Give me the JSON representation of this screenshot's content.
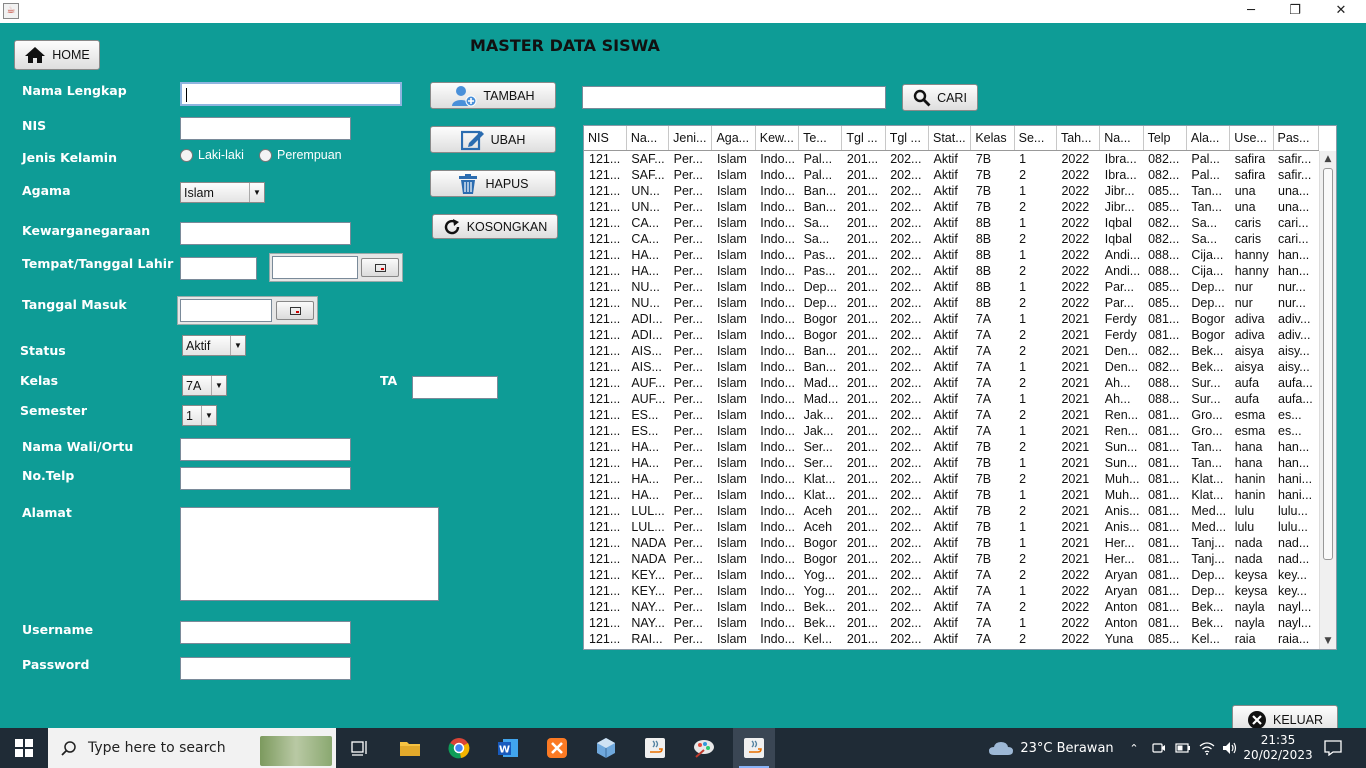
{
  "window": {
    "minimize_icon": "─",
    "maximize_icon": "❐",
    "close_icon": "✕"
  },
  "form": {
    "title": "MASTER DATA SISWA",
    "home_label": "HOME",
    "labels": {
      "nama_lengkap": "Nama Lengkap",
      "nis": "NIS",
      "jenis_kelamin": "Jenis Kelamin",
      "agama": "Agama",
      "kewarganegaraan": "Kewarganegaraan",
      "tempat_tanggal_lahir": "Tempat/Tanggal Lahir",
      "tanggal_masuk": "Tanggal Masuk",
      "status": "Status",
      "kelas": "Kelas",
      "semester": "Semester",
      "ta": "TA",
      "nama_wali": "Nama Wali/Ortu",
      "no_telp": "No.Telp",
      "alamat": "Alamat",
      "username": "Username",
      "password": "Password"
    },
    "gender_options": [
      "Laki-laki",
      "Perempuan"
    ],
    "agama_value": "Islam",
    "status_value": "Aktif",
    "kelas_value": "7A",
    "semester_value": "1",
    "buttons": {
      "tambah": "TAMBAH",
      "ubah": "UBAH",
      "hapus": "HAPUS",
      "kosongkan": "KOSONGKAN",
      "cari": "CARI",
      "keluar": "KELUAR"
    }
  },
  "table": {
    "columns": [
      "NIS",
      "Na...",
      "Jeni...",
      "Aga...",
      "Kew...",
      "Te...",
      "Tgl ...",
      "Tgl ...",
      "Stat...",
      "Kelas",
      "Se...",
      "Tah...",
      "Na...",
      "Telp",
      "Ala...",
      "Use...",
      "Pas..."
    ],
    "rows": [
      [
        "121...",
        "SAF...",
        "Per...",
        "Islam",
        "Indo...",
        "Pal...",
        "201...",
        "202...",
        "Aktif",
        "7B",
        "1",
        "2022",
        "Ibra...",
        "082...",
        "Pal...",
        "safira",
        "safir..."
      ],
      [
        "121...",
        "SAF...",
        "Per...",
        "Islam",
        "Indo...",
        "Pal...",
        "201...",
        "202...",
        "Aktif",
        "7B",
        "2",
        "2022",
        "Ibra...",
        "082...",
        "Pal...",
        "safira",
        "safir..."
      ],
      [
        "121...",
        "UN...",
        "Per...",
        "Islam",
        "Indo...",
        "Ban...",
        "201...",
        "202...",
        "Aktif",
        "7B",
        "1",
        "2022",
        "Jibr...",
        "085...",
        "Tan...",
        "una",
        "una..."
      ],
      [
        "121...",
        "UN...",
        "Per...",
        "Islam",
        "Indo...",
        "Ban...",
        "201...",
        "202...",
        "Aktif",
        "7B",
        "2",
        "2022",
        "Jibr...",
        "085...",
        "Tan...",
        "una",
        "una..."
      ],
      [
        "121...",
        "CA...",
        "Per...",
        "Islam",
        "Indo...",
        "Sa...",
        "201...",
        "202...",
        "Aktif",
        "8B",
        "1",
        "2022",
        "Iqbal",
        "082...",
        "Sa...",
        "caris",
        "cari..."
      ],
      [
        "121...",
        "CA...",
        "Per...",
        "Islam",
        "Indo...",
        "Sa...",
        "201...",
        "202...",
        "Aktif",
        "8B",
        "2",
        "2022",
        "Iqbal",
        "082...",
        "Sa...",
        "caris",
        "cari..."
      ],
      [
        "121...",
        "HA...",
        "Per...",
        "Islam",
        "Indo...",
        "Pas...",
        "201...",
        "202...",
        "Aktif",
        "8B",
        "1",
        "2022",
        "Andi...",
        "088...",
        "Cija...",
        "hanny",
        "han..."
      ],
      [
        "121...",
        "HA...",
        "Per...",
        "Islam",
        "Indo...",
        "Pas...",
        "201...",
        "202...",
        "Aktif",
        "8B",
        "2",
        "2022",
        "Andi...",
        "088...",
        "Cija...",
        "hanny",
        "han..."
      ],
      [
        "121...",
        "NU...",
        "Per...",
        "Islam",
        "Indo...",
        "Dep...",
        "201...",
        "202...",
        "Aktif",
        "8B",
        "1",
        "2022",
        "Par...",
        "085...",
        "Dep...",
        "nur",
        "nur..."
      ],
      [
        "121...",
        "NU...",
        "Per...",
        "Islam",
        "Indo...",
        "Dep...",
        "201...",
        "202...",
        "Aktif",
        "8B",
        "2",
        "2022",
        "Par...",
        "085...",
        "Dep...",
        "nur",
        "nur..."
      ],
      [
        "121...",
        "ADI...",
        "Per...",
        "Islam",
        "Indo...",
        "Bogor",
        "201...",
        "202...",
        "Aktif",
        "7A",
        "1",
        "2021",
        "Ferdy",
        "081...",
        "Bogor",
        "adiva",
        "adiv..."
      ],
      [
        "121...",
        "ADI...",
        "Per...",
        "Islam",
        "Indo...",
        "Bogor",
        "201...",
        "202...",
        "Aktif",
        "7A",
        "2",
        "2021",
        "Ferdy",
        "081...",
        "Bogor",
        "adiva",
        "adiv..."
      ],
      [
        "121...",
        "AIS...",
        "Per...",
        "Islam",
        "Indo...",
        "Ban...",
        "201...",
        "202...",
        "Aktif",
        "7A",
        "2",
        "2021",
        "Den...",
        "082...",
        "Bek...",
        "aisya",
        "aisy..."
      ],
      [
        "121...",
        "AIS...",
        "Per...",
        "Islam",
        "Indo...",
        "Ban...",
        "201...",
        "202...",
        "Aktif",
        "7A",
        "1",
        "2021",
        "Den...",
        "082...",
        "Bek...",
        "aisya",
        "aisy..."
      ],
      [
        "121...",
        "AUF...",
        "Per...",
        "Islam",
        "Indo...",
        "Mad...",
        "201...",
        "202...",
        "Aktif",
        "7A",
        "2",
        "2021",
        "Ah...",
        "088...",
        "Sur...",
        "aufa",
        "aufa..."
      ],
      [
        "121...",
        "AUF...",
        "Per...",
        "Islam",
        "Indo...",
        "Mad...",
        "201...",
        "202...",
        "Aktif",
        "7A",
        "1",
        "2021",
        "Ah...",
        "088...",
        "Sur...",
        "aufa",
        "aufa..."
      ],
      [
        "121...",
        "ES...",
        "Per...",
        "Islam",
        "Indo...",
        "Jak...",
        "201...",
        "202...",
        "Aktif",
        "7A",
        "2",
        "2021",
        "Ren...",
        "081...",
        "Gro...",
        "esma",
        "es..."
      ],
      [
        "121...",
        "ES...",
        "Per...",
        "Islam",
        "Indo...",
        "Jak...",
        "201...",
        "202...",
        "Aktif",
        "7A",
        "1",
        "2021",
        "Ren...",
        "081...",
        "Gro...",
        "esma",
        "es..."
      ],
      [
        "121...",
        "HA...",
        "Per...",
        "Islam",
        "Indo...",
        "Ser...",
        "201...",
        "202...",
        "Aktif",
        "7B",
        "2",
        "2021",
        "Sun...",
        "081...",
        "Tan...",
        "hana",
        "han..."
      ],
      [
        "121...",
        "HA...",
        "Per...",
        "Islam",
        "Indo...",
        "Ser...",
        "201...",
        "202...",
        "Aktif",
        "7B",
        "1",
        "2021",
        "Sun...",
        "081...",
        "Tan...",
        "hana",
        "han..."
      ],
      [
        "121...",
        "HA...",
        "Per...",
        "Islam",
        "Indo...",
        "Klat...",
        "201...",
        "202...",
        "Aktif",
        "7B",
        "2",
        "2021",
        "Muh...",
        "081...",
        "Klat...",
        "hanin",
        "hani..."
      ],
      [
        "121...",
        "HA...",
        "Per...",
        "Islam",
        "Indo...",
        "Klat...",
        "201...",
        "202...",
        "Aktif",
        "7B",
        "1",
        "2021",
        "Muh...",
        "081...",
        "Klat...",
        "hanin",
        "hani..."
      ],
      [
        "121...",
        "LUL...",
        "Per...",
        "Islam",
        "Indo...",
        "Aceh",
        "201...",
        "202...",
        "Aktif",
        "7B",
        "2",
        "2021",
        "Anis...",
        "081...",
        "Med...",
        "lulu",
        "lulu..."
      ],
      [
        "121...",
        "LUL...",
        "Per...",
        "Islam",
        "Indo...",
        "Aceh",
        "201...",
        "202...",
        "Aktif",
        "7B",
        "1",
        "2021",
        "Anis...",
        "081...",
        "Med...",
        "lulu",
        "lulu..."
      ],
      [
        "121...",
        "NADA",
        "Per...",
        "Islam",
        "Indo...",
        "Bogor",
        "201...",
        "202...",
        "Aktif",
        "7B",
        "1",
        "2021",
        "Her...",
        "081...",
        "Tanj...",
        "nada",
        "nad..."
      ],
      [
        "121...",
        "NADA",
        "Per...",
        "Islam",
        "Indo...",
        "Bogor",
        "201...",
        "202...",
        "Aktif",
        "7B",
        "2",
        "2021",
        "Her...",
        "081...",
        "Tanj...",
        "nada",
        "nad..."
      ],
      [
        "121...",
        "KEY...",
        "Per...",
        "Islam",
        "Indo...",
        "Yog...",
        "201...",
        "202...",
        "Aktif",
        "7A",
        "2",
        "2022",
        "Aryan",
        "081...",
        "Dep...",
        "keysa",
        "key..."
      ],
      [
        "121...",
        "KEY...",
        "Per...",
        "Islam",
        "Indo...",
        "Yog...",
        "201...",
        "202...",
        "Aktif",
        "7A",
        "1",
        "2022",
        "Aryan",
        "081...",
        "Dep...",
        "keysa",
        "key..."
      ],
      [
        "121...",
        "NAY...",
        "Per...",
        "Islam",
        "Indo...",
        "Bek...",
        "201...",
        "202...",
        "Aktif",
        "7A",
        "2",
        "2022",
        "Anton",
        "081...",
        "Bek...",
        "nayla",
        "nayl..."
      ],
      [
        "121...",
        "NAY...",
        "Per...",
        "Islam",
        "Indo...",
        "Bek...",
        "201...",
        "202...",
        "Aktif",
        "7A",
        "1",
        "2022",
        "Anton",
        "081...",
        "Bek...",
        "nayla",
        "nayl..."
      ],
      [
        "121...",
        "RAI...",
        "Per...",
        "Islam",
        "Indo...",
        "Kel...",
        "201...",
        "202...",
        "Aktif",
        "7A",
        "2",
        "2022",
        "Yuna",
        "085...",
        "Kel...",
        "raia",
        "raia..."
      ]
    ]
  },
  "taskbar": {
    "search_placeholder": "Type here to search",
    "weather": "23°C  Berawan",
    "time": "21:35",
    "date": "20/02/2023"
  },
  "colors": {
    "background": "#0e9c96",
    "taskbar": "#1f2b36"
  }
}
